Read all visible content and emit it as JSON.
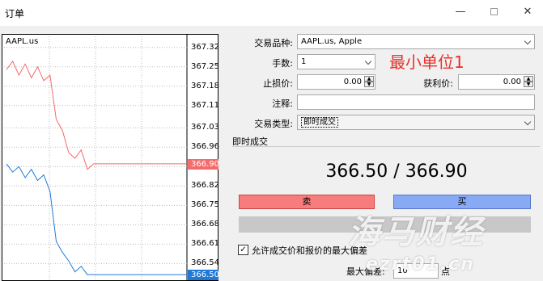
{
  "window": {
    "title": "订单",
    "min_glyph": "—",
    "close_glyph": "✕"
  },
  "chart": {
    "symbol": "AAPL.us",
    "ticks": [
      "367.32",
      "367.25",
      "367.18",
      "367.11",
      "367.03",
      "366.96",
      "366.89",
      "366.82",
      "366.75",
      "366.68",
      "366.61",
      "366.54"
    ],
    "ask_tag": "366.90",
    "bid_tag": "366.50",
    "ask_color": "#f36b6b",
    "bid_color": "#1e7ad6"
  },
  "chart_data": {
    "type": "line",
    "title": "",
    "ylim": [
      366.48,
      367.36
    ],
    "series": [
      {
        "values": [
          367.24,
          367.27,
          367.22,
          367.26,
          367.21,
          367.25,
          367.2,
          367.22,
          367.06,
          367.02,
          366.94,
          366.92,
          366.95,
          366.88,
          366.9,
          366.9,
          366.9,
          366.9,
          366.9,
          366.9,
          366.9,
          366.9,
          366.9,
          366.9,
          366.9,
          366.9,
          366.9,
          366.9,
          366.9,
          366.9
        ],
        "color": "#f36b6b"
      },
      {
        "values": [
          366.9,
          366.87,
          366.89,
          366.85,
          366.88,
          366.84,
          366.86,
          366.8,
          366.62,
          366.58,
          366.55,
          366.51,
          366.53,
          366.5,
          366.5,
          366.5,
          366.5,
          366.5,
          366.5,
          366.5,
          366.5,
          366.5,
          366.5,
          366.5,
          366.5,
          366.5,
          366.5,
          366.5,
          366.5,
          366.5
        ],
        "color": "#1e7ad6"
      }
    ],
    "grid": true
  },
  "form": {
    "symbol_label": "交易品种:",
    "symbol_value": "AAPL.us, Apple",
    "volume_label": "手数:",
    "volume_value": "1",
    "sl_label": "止损价:",
    "sl_value": "0.00",
    "tp_label": "获利价:",
    "tp_value": "0.00",
    "comment_label": "注释:",
    "comment_value": "",
    "type_label": "交易类型:",
    "type_value": "即时成交"
  },
  "annotation": "最小单位1",
  "execution": {
    "section_label": "即时成交",
    "quote": "366.50 / 366.90",
    "sell_label": "卖",
    "buy_label": "买",
    "allow_deviation_label": "允许成交价和报价的最大偏差",
    "allow_deviation_checked": "✓",
    "max_deviation_label": "最大偏差:",
    "max_deviation_value": "10",
    "points_label": "点"
  },
  "watermark": {
    "big": "海马财经",
    "small": "ezrt01.cn"
  }
}
